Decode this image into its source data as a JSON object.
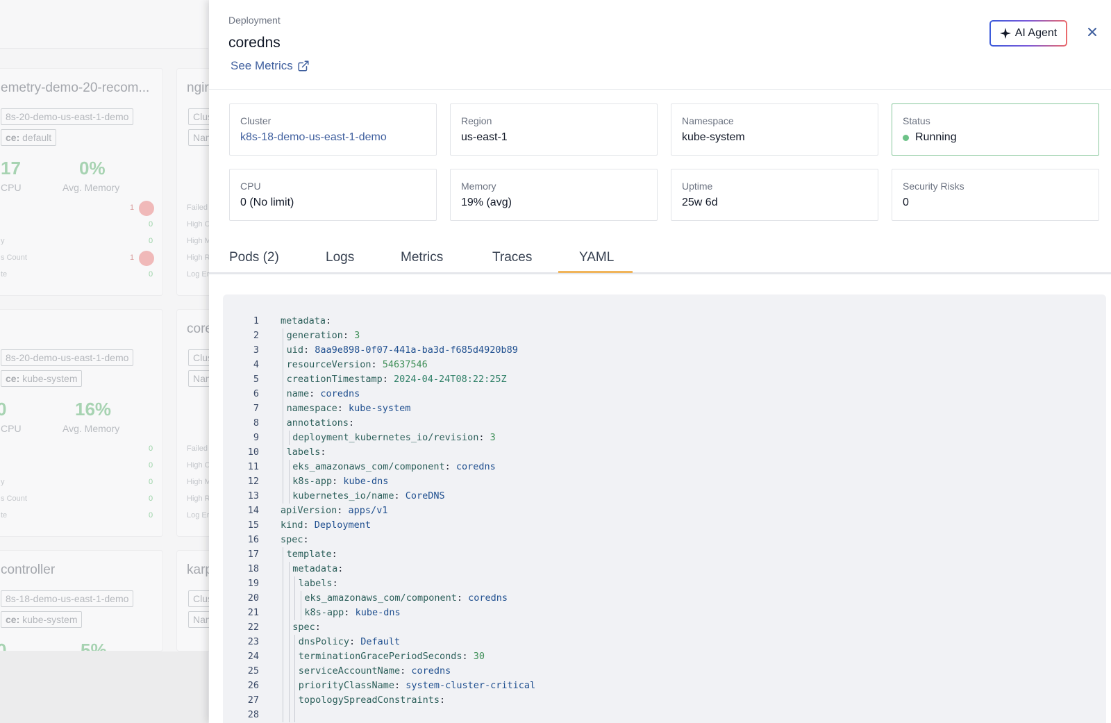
{
  "background": {
    "cards": [
      {
        "title": "emetry-demo-20-recom...",
        "cluster_tag": "8s-20-demo-us-east-1-demo",
        "ns_label": "ce:",
        "ns_value": "default",
        "cpu": "17",
        "cpu_label": "CPU",
        "mem": "0%",
        "mem_label": "Avg. Memory",
        "rows": [
          {
            "label": "",
            "value": "1",
            "red": true
          },
          {
            "label": "",
            "value": "0"
          },
          {
            "label": "y",
            "value": "0"
          },
          {
            "label": "s Count",
            "value": "1",
            "red": true
          },
          {
            "label": "te",
            "value": "0"
          }
        ]
      },
      {
        "title": "",
        "cluster_tag": "8s-20-demo-us-east-1-demo",
        "ns_label": "ce:",
        "ns_value": "kube-system",
        "cpu": "0",
        "cpu_label": "CPU",
        "mem": "16%",
        "mem_label": "Avg. Memory",
        "rows": [
          {
            "label": "",
            "value": "0"
          },
          {
            "label": "",
            "value": "0"
          },
          {
            "label": "y",
            "value": "0"
          },
          {
            "label": "s Count",
            "value": "0"
          },
          {
            "label": "te",
            "value": "0"
          }
        ]
      },
      {
        "title": "controller",
        "cluster_tag": "8s-18-demo-us-east-1-demo",
        "ns_label": "ce:",
        "ns_value": "kube-system",
        "cpu": "0",
        "mem": "5%"
      }
    ],
    "side_cards": [
      {
        "title": "ngir",
        "tag1": "Clus",
        "tag2": "Nam",
        "rows": [
          "Failed",
          "High C",
          "High M",
          "High R",
          "Log Er"
        ]
      },
      {
        "title": "core",
        "tag1": "Clus",
        "tag2": "Nam",
        "rows": [
          "Failed",
          "High C",
          "High M",
          "High R",
          "Log Er"
        ]
      },
      {
        "title": "karp",
        "tag1": "Clus",
        "tag2": "Nam"
      }
    ]
  },
  "drawer": {
    "eyebrow": "Deployment",
    "title": "coredns",
    "see_metrics": "See Metrics",
    "ai_agent": "AI Agent",
    "info": [
      {
        "label": "Cluster",
        "value": "k8s-18-demo-us-east-1-demo"
      },
      {
        "label": "Region",
        "value": "us-east-1"
      },
      {
        "label": "Namespace",
        "value": "kube-system"
      },
      {
        "label": "Status",
        "value": "Running",
        "status_color": "#6cc287"
      },
      {
        "label": "CPU",
        "value": "0 (No limit)"
      },
      {
        "label": "Memory",
        "value": "19% (avg)"
      },
      {
        "label": "Uptime",
        "value": "25w 6d"
      },
      {
        "label": "Security Risks",
        "value": "0"
      }
    ],
    "tabs": [
      {
        "label": "Pods (2)"
      },
      {
        "label": "Logs"
      },
      {
        "label": "Metrics"
      },
      {
        "label": "Traces"
      },
      {
        "label": "YAML",
        "active": true
      }
    ],
    "yaml_lines": [
      {
        "n": "1",
        "indent": 0,
        "key": "metadata",
        "val": ""
      },
      {
        "n": "2",
        "indent": 1,
        "key": "generation",
        "val": "3",
        "type": "num"
      },
      {
        "n": "3",
        "indent": 1,
        "key": "uid",
        "val": "8aa9e898-0f07-441a-ba3d-f685d4920b89"
      },
      {
        "n": "4",
        "indent": 1,
        "key": "resourceVersion",
        "val": "54637546",
        "type": "num"
      },
      {
        "n": "5",
        "indent": 1,
        "key": "creationTimestamp",
        "val": "2024-04-24T08:22:25Z",
        "type": "date"
      },
      {
        "n": "6",
        "indent": 1,
        "key": "name",
        "val": "coredns"
      },
      {
        "n": "7",
        "indent": 1,
        "key": "namespace",
        "val": "kube-system"
      },
      {
        "n": "8",
        "indent": 1,
        "key": "annotations",
        "val": ""
      },
      {
        "n": "9",
        "indent": 2,
        "key": "deployment_kubernetes_io/revision",
        "val": "3",
        "type": "num"
      },
      {
        "n": "10",
        "indent": 1,
        "key": "labels",
        "val": ""
      },
      {
        "n": "11",
        "indent": 2,
        "key": "eks_amazonaws_com/component",
        "val": "coredns"
      },
      {
        "n": "12",
        "indent": 2,
        "key": "k8s-app",
        "val": "kube-dns"
      },
      {
        "n": "13",
        "indent": 2,
        "key": "kubernetes_io/name",
        "val": "CoreDNS"
      },
      {
        "n": "14",
        "indent": 0,
        "key": "apiVersion",
        "val": "apps/v1"
      },
      {
        "n": "15",
        "indent": 0,
        "key": "kind",
        "val": "Deployment"
      },
      {
        "n": "16",
        "indent": 0,
        "key": "spec",
        "val": ""
      },
      {
        "n": "17",
        "indent": 1,
        "key": "template",
        "val": ""
      },
      {
        "n": "18",
        "indent": 2,
        "key": "metadata",
        "val": ""
      },
      {
        "n": "19",
        "indent": 3,
        "key": "labels",
        "val": ""
      },
      {
        "n": "20",
        "indent": 4,
        "key": "eks_amazonaws_com/component",
        "val": "coredns"
      },
      {
        "n": "21",
        "indent": 4,
        "key": "k8s-app",
        "val": "kube-dns"
      },
      {
        "n": "22",
        "indent": 2,
        "key": "spec",
        "val": ""
      },
      {
        "n": "23",
        "indent": 3,
        "key": "dnsPolicy",
        "val": "Default"
      },
      {
        "n": "24",
        "indent": 3,
        "key": "terminationGracePeriodSeconds",
        "val": "30",
        "type": "num"
      },
      {
        "n": "25",
        "indent": 3,
        "key": "serviceAccountName",
        "val": "coredns"
      },
      {
        "n": "26",
        "indent": 3,
        "key": "priorityClassName",
        "val": "system-cluster-critical"
      },
      {
        "n": "27",
        "indent": 3,
        "key": "topologySpreadConstraints",
        "val": ""
      },
      {
        "n": "28",
        "indent": 3,
        "key": "",
        "val": ""
      }
    ]
  }
}
